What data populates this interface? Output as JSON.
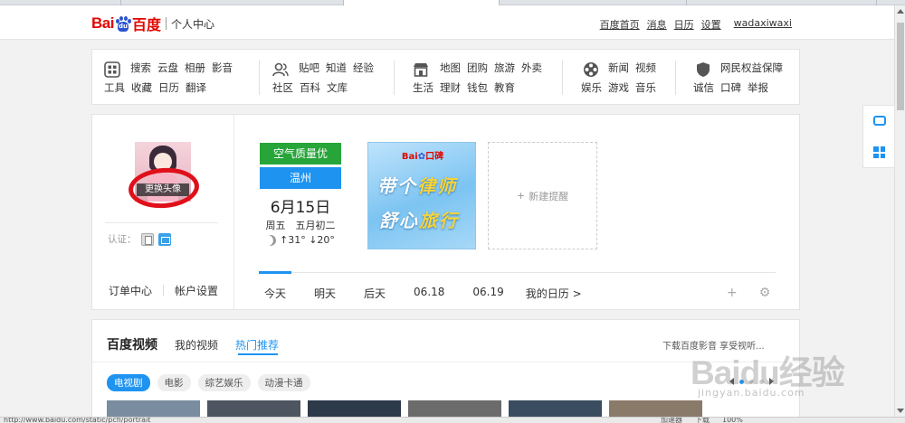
{
  "header": {
    "logo_bai": "Bai",
    "logo_du": "du",
    "logo_baidu": "百度",
    "logo_sub": "个人中心",
    "links": [
      "百度首页",
      "消息",
      "日历",
      "设置"
    ],
    "username": "wadaxiwaxi"
  },
  "nav": {
    "groups": [
      {
        "icon": "grid-icon",
        "row1": [
          "搜索",
          "云盘",
          "相册",
          "影音"
        ],
        "row2": [
          "工具",
          "收藏",
          "日历",
          "翻译"
        ]
      },
      {
        "icon": "people-icon",
        "row1": [
          "贴吧",
          "知道",
          "经验"
        ],
        "row2": [
          "社区",
          "百科",
          "文库"
        ]
      },
      {
        "icon": "shop-icon",
        "row1": [
          "地图",
          "团购",
          "旅游",
          "外卖"
        ],
        "row2": [
          "生活",
          "理财",
          "钱包",
          "教育"
        ]
      },
      {
        "icon": "film-reel-icon",
        "row1": [
          "新闻",
          "视频"
        ],
        "row2": [
          "娱乐",
          "游戏",
          "音乐"
        ]
      },
      {
        "icon": "shield-icon",
        "row1": [
          "网民权益保障"
        ],
        "row2": [
          "诚信",
          "口碑",
          "举报"
        ]
      }
    ]
  },
  "profile": {
    "avatar_button": "更换头像",
    "verify_label": "认证：",
    "order_center": "订单中心",
    "account_settings": "帐户设置"
  },
  "calendar": {
    "air_quality": "空气质量优",
    "city": "温州",
    "date": "6月15日",
    "weekday_lunar": "周五　五月初二",
    "temp": "↑31° ↓20°",
    "banner_head": "Bai",
    "banner_head2": "口碑",
    "banner_line1_a": "带个",
    "banner_line1_b": "律师",
    "banner_line2_a": "舒心",
    "banner_line2_b": "旅行",
    "new_reminder": "新建提醒",
    "tabs": [
      "今天",
      "明天",
      "后天",
      "06.18",
      "06.19"
    ],
    "my_calendar": "我的日历 >"
  },
  "video": {
    "title": "百度视频",
    "tab_mine": "我的视频",
    "tab_hot": "热门推荐",
    "right_text": "下载百度影音 享受视听...",
    "chips": [
      "电视剧",
      "电影",
      "综艺娱乐",
      "动漫卡通"
    ]
  },
  "watermark": {
    "text": "Baidu经验",
    "url": "jingyan.baidu.com"
  },
  "statusbar": {
    "url": "http://www.baidu.com/static/pcfl/portrait",
    "items": [
      "加速器",
      "下载",
      "100%"
    ]
  },
  "colors": {
    "accent_blue": "#1f93f0",
    "air_green": "#27a539",
    "annotation_red": "#e0101a",
    "brand_red": "#e10601"
  }
}
